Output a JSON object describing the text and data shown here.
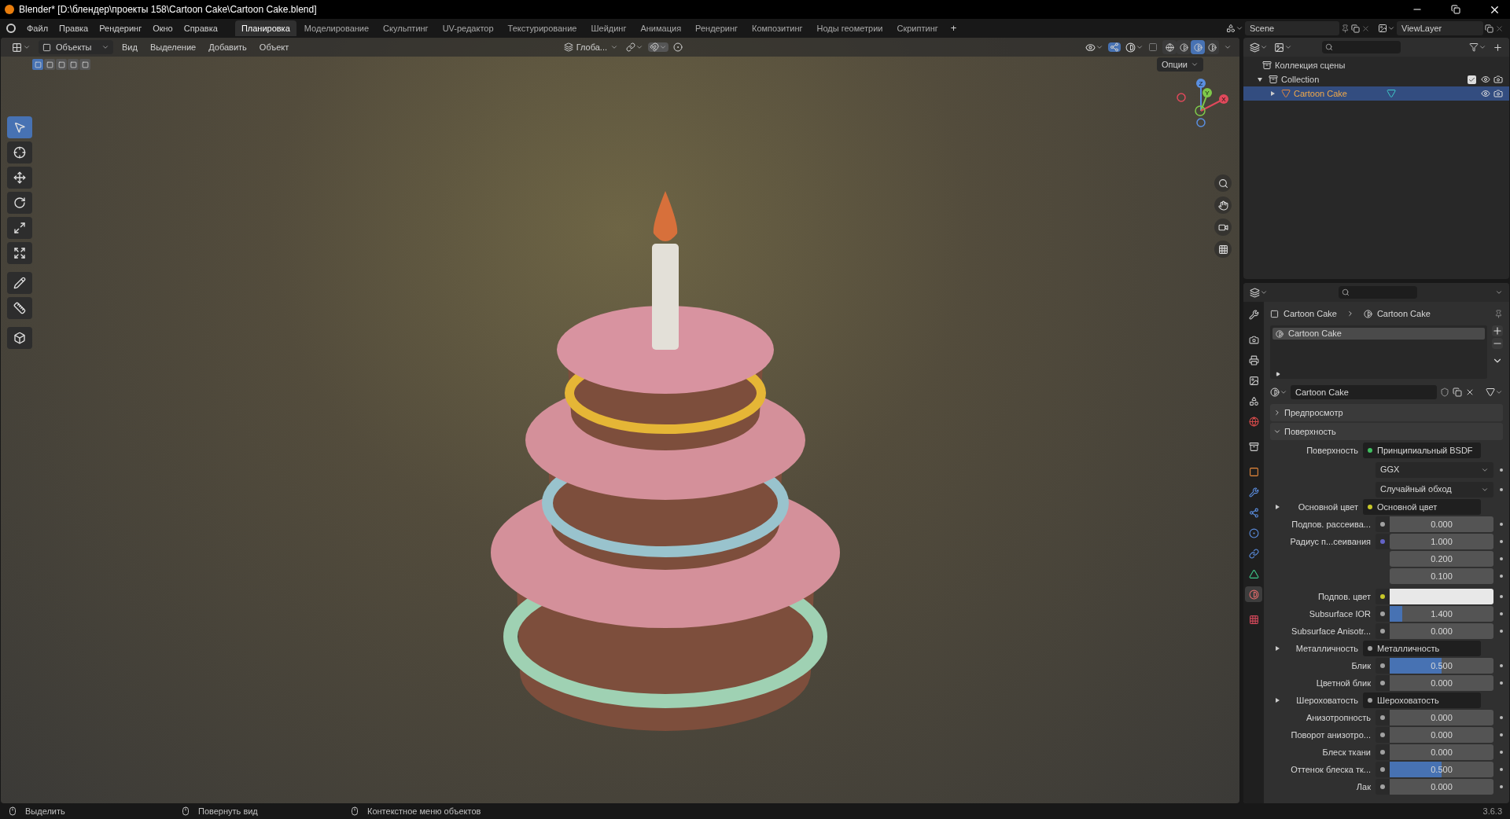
{
  "window": {
    "title": "Blender* [D:\\блендер\\проекты 158\\Cartoon Cake\\Cartoon Cake.blend]"
  },
  "menu": [
    "Файл",
    "Правка",
    "Рендеринг",
    "Окно",
    "Справка"
  ],
  "workspaces": [
    {
      "label": "Планировка",
      "selected": true
    },
    {
      "label": "Моделирование",
      "selected": false
    },
    {
      "label": "Скульптинг",
      "selected": false
    },
    {
      "label": "UV-редактор",
      "selected": false
    },
    {
      "label": "Текстурирование",
      "selected": false
    },
    {
      "label": "Шейдинг",
      "selected": false
    },
    {
      "label": "Анимация",
      "selected": false
    },
    {
      "label": "Рендеринг",
      "selected": false
    },
    {
      "label": "Композитинг",
      "selected": false
    },
    {
      "label": "Ноды геометрии",
      "selected": false
    },
    {
      "label": "Скриптинг",
      "selected": false
    }
  ],
  "add_workspace": "+",
  "scene": {
    "scene": "Scene",
    "view_layer": "ViewLayer"
  },
  "viewport": {
    "mode": "Объекты",
    "menus": [
      "Вид",
      "Выделение",
      "Добавить",
      "Объект"
    ],
    "orientation": "Глоба...",
    "options": "Опции",
    "select_modes": [
      {
        "selected": true
      },
      {
        "selected": false
      },
      {
        "selected": false
      },
      {
        "selected": false
      },
      {
        "selected": false
      }
    ],
    "tools": [
      {
        "selected": true
      },
      {
        "selected": false
      },
      {
        "selected": false
      },
      {
        "selected": false
      },
      {
        "selected": false
      },
      {
        "selected": false
      },
      {
        "selected": false
      },
      {
        "selected": false
      },
      {
        "selected": false
      }
    ],
    "shading": [
      {
        "selected": false
      },
      {
        "selected": false
      },
      {
        "selected": true
      },
      {
        "selected": false
      }
    ],
    "gizmo_axes": [
      "Z",
      "Y",
      "X"
    ]
  },
  "outliner": {
    "root": "Коллекция сцены",
    "children": [
      {
        "label": "Collection",
        "expanded": true,
        "checked": true,
        "selected": false,
        "children": [
          {
            "label": "Cartoon Cake",
            "expanded": false,
            "selected": true
          }
        ]
      }
    ]
  },
  "properties": {
    "tabs": [
      {
        "selected": false
      },
      {
        "selected": false
      },
      {
        "selected": false
      },
      {
        "selected": false
      },
      {
        "selected": false
      },
      {
        "selected": false
      },
      {
        "selected": false
      },
      {
        "selected": false
      },
      {
        "selected": false
      },
      {
        "selected": false
      },
      {
        "selected": false
      },
      {
        "selected": false
      },
      {
        "selected": false
      },
      {
        "selected": true
      },
      {
        "selected": false
      }
    ],
    "breadcrumb": [
      "Cartoon Cake",
      "Cartoon Cake"
    ],
    "slots": [
      {
        "label": "Cartoon Cake",
        "selected": true
      }
    ],
    "material": "Cartoon Cake",
    "panels": [
      {
        "title": "Предпросмотр",
        "expanded": false
      },
      {
        "title": "Поверхность",
        "expanded": true
      }
    ],
    "rows": [
      {
        "kind": "socket",
        "label": "Поверхность",
        "color": "#3fbf5f",
        "value": "Принципиальный BSDF"
      },
      {
        "kind": "dropdown",
        "value": "GGX"
      },
      {
        "kind": "dropdown",
        "value": "Случайный обход"
      },
      {
        "kind": "input",
        "label": "Основной цвет",
        "color": "#c7c729",
        "value": "Основной цвет",
        "expanded": false
      },
      {
        "kind": "number",
        "label": "Подпов. рассеива...",
        "color": "#a1a1a1",
        "value": "0.000"
      },
      {
        "kind": "vector",
        "label": "Радиус п...сеивания",
        "color": "#6363c7",
        "values": [
          "1.000",
          "0.200",
          "0.100"
        ]
      },
      {
        "kind": "swatch",
        "label": "Подпов. цвет",
        "color": "#c7c729"
      },
      {
        "kind": "slider",
        "label": "Subsurface IOR",
        "color": "#a1a1a1",
        "value": "1.400",
        "level": 0.12
      },
      {
        "kind": "number",
        "label": "Subsurface Anisotr...",
        "color": "#a1a1a1",
        "value": "0.000"
      },
      {
        "kind": "input",
        "label": "Металличность",
        "color": "#a1a1a1",
        "value": "Металличность",
        "expanded": false
      },
      {
        "kind": "slider",
        "label": "Блик",
        "color": "#a1a1a1",
        "value": "0.500",
        "level": 0.5
      },
      {
        "kind": "number",
        "label": "Цветной блик",
        "color": "#a1a1a1",
        "value": "0.000"
      },
      {
        "kind": "input",
        "label": "Шероховатость",
        "color": "#a1a1a1",
        "value": "Шероховатость",
        "expanded": false
      },
      {
        "kind": "number",
        "label": "Анизотропность",
        "color": "#a1a1a1",
        "value": "0.000"
      },
      {
        "kind": "number",
        "label": "Поворот анизотро...",
        "color": "#a1a1a1",
        "value": "0.000"
      },
      {
        "kind": "number",
        "label": "Блеск ткани",
        "color": "#a1a1a1",
        "value": "0.000"
      },
      {
        "kind": "slider",
        "label": "Оттенок блеска тк...",
        "color": "#a1a1a1",
        "value": "0.500",
        "level": 0.5
      },
      {
        "kind": "number",
        "label": "Лак",
        "color": "#a1a1a1",
        "value": "0.000"
      }
    ]
  },
  "status_bar": {
    "hints": [
      "Выделить",
      "Повернуть вид",
      "Контекстное меню объектов"
    ],
    "version": "3.6.3"
  }
}
